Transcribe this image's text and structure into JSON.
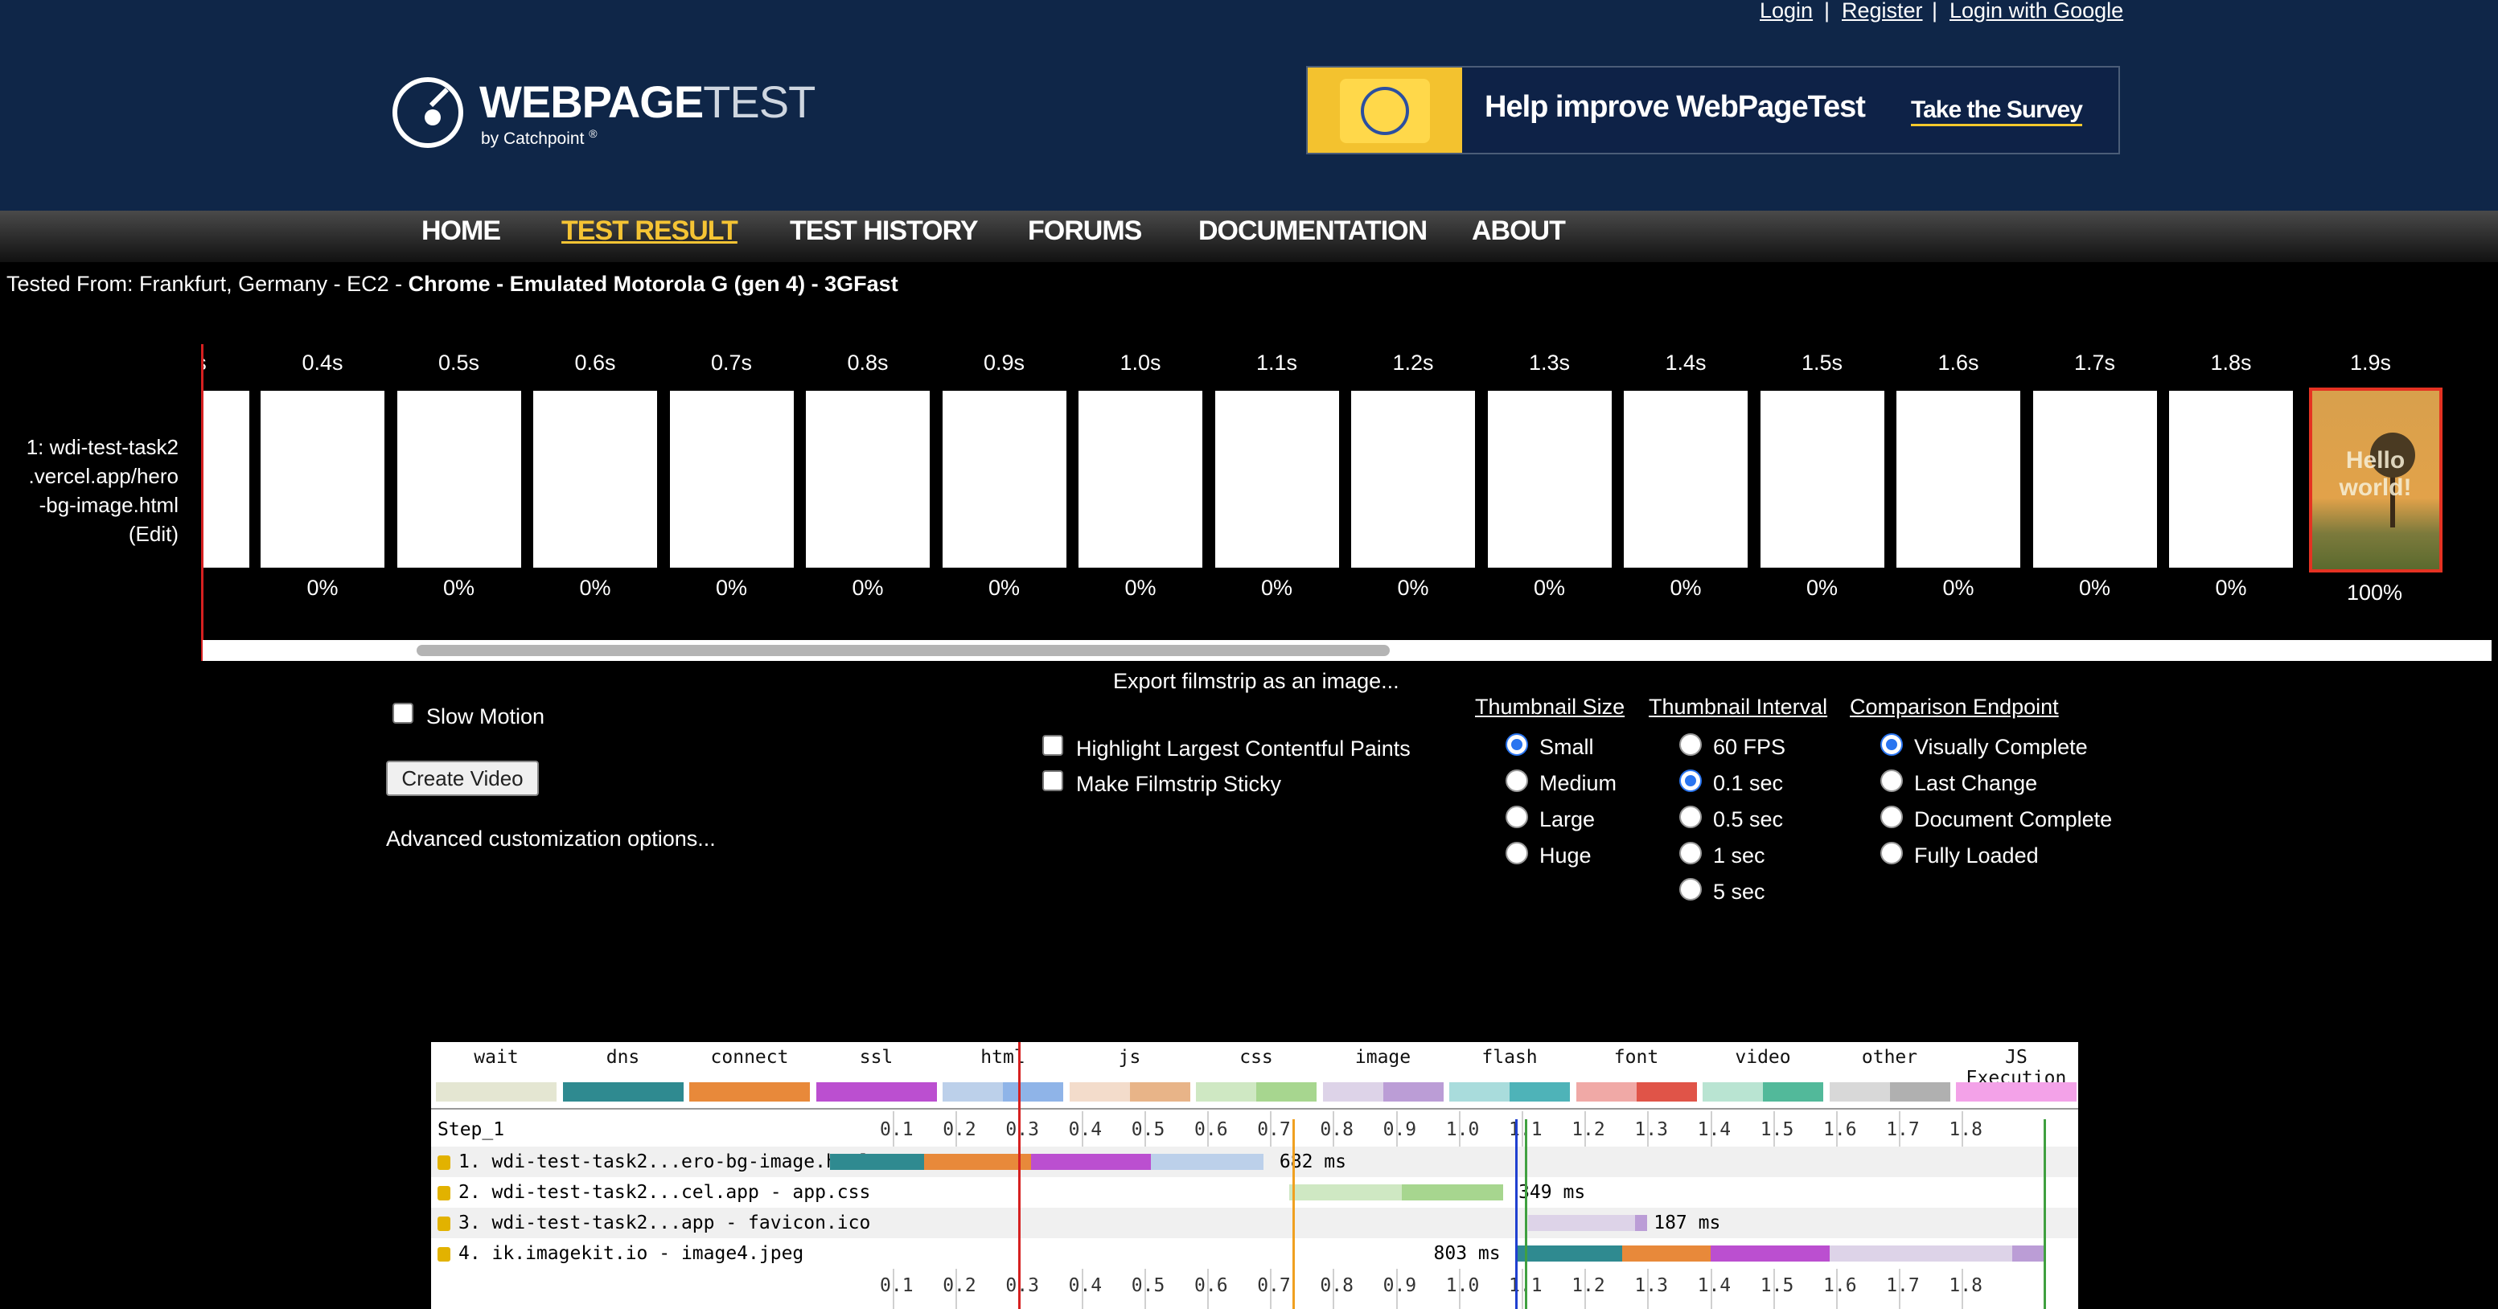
{
  "toplinks": {
    "login": "Login",
    "register": "Register",
    "google": "Login with Google",
    "sep": "|"
  },
  "logo": {
    "brand_bold": "WEBPAGE",
    "brand_thin": "TEST",
    "sub": "by Catchpoint",
    "reg": "®",
    "icon": "speedometer-icon"
  },
  "banner": {
    "text": "Help improve WebPageTest",
    "cta": "Take the Survey"
  },
  "nav": [
    "HOME",
    "TEST RESULT",
    "TEST HISTORY",
    "FORUMS",
    "DOCUMENTATION",
    "ABOUT"
  ],
  "nav_active": "TEST RESULT",
  "tested_from": {
    "prefix": "Tested From: Frankfurt, Germany - EC2 - ",
    "bold": "Chrome - Emulated Motorola G (gen 4) - 3GFast"
  },
  "filmstrip": {
    "row_label": [
      "1: wdi-test-task2",
      ".vercel.app/hero",
      "-bg-image.html",
      "(Edit)"
    ],
    "partial_label": "s",
    "frames": [
      {
        "time": "0.4s",
        "pct": "0%"
      },
      {
        "time": "0.5s",
        "pct": "0%"
      },
      {
        "time": "0.6s",
        "pct": "0%"
      },
      {
        "time": "0.7s",
        "pct": "0%"
      },
      {
        "time": "0.8s",
        "pct": "0%"
      },
      {
        "time": "0.9s",
        "pct": "0%"
      },
      {
        "time": "1.0s",
        "pct": "0%"
      },
      {
        "time": "1.1s",
        "pct": "0%"
      },
      {
        "time": "1.2s",
        "pct": "0%"
      },
      {
        "time": "1.3s",
        "pct": "0%"
      },
      {
        "time": "1.4s",
        "pct": "0%"
      },
      {
        "time": "1.5s",
        "pct": "0%"
      },
      {
        "time": "1.6s",
        "pct": "0%"
      },
      {
        "time": "1.7s",
        "pct": "0%"
      },
      {
        "time": "1.8s",
        "pct": "0%"
      }
    ],
    "last_frame": {
      "time": "1.9s",
      "pct": "100%",
      "text": [
        "Hello",
        "world!"
      ]
    }
  },
  "controls": {
    "slow_motion": "Slow Motion",
    "create_video": "Create Video",
    "advanced": "Advanced customization options...",
    "export": "Export filmstrip as an image...",
    "highlight_lcp": "Highlight Largest Contentful Paints",
    "sticky": "Make Filmstrip Sticky",
    "thumb_size": {
      "title": "Thumbnail Size",
      "options": [
        "Small",
        "Medium",
        "Large",
        "Huge"
      ],
      "selected": 0
    },
    "thumb_interval": {
      "title": "Thumbnail Interval",
      "options": [
        "60 FPS",
        "0.1 sec",
        "0.5 sec",
        "1 sec",
        "5 sec"
      ],
      "selected": 1
    },
    "endpoint": {
      "title": "Comparison Endpoint",
      "options": [
        "Visually Complete",
        "Last Change",
        "Document Complete",
        "Fully Loaded"
      ],
      "selected": 0
    }
  },
  "waterfall": {
    "legend": [
      {
        "label": "wait",
        "colors": [
          "#e4e6d2",
          "#e4e6d2"
        ]
      },
      {
        "label": "dns",
        "colors": [
          "#2f8a90",
          "#2f8a90"
        ]
      },
      {
        "label": "connect",
        "colors": [
          "#e8893a",
          "#e8893a"
        ]
      },
      {
        "label": "ssl",
        "colors": [
          "#bb4fd0",
          "#bb4fd0"
        ]
      },
      {
        "label": "html",
        "colors": [
          "#bcd0ea",
          "#8fb4e8"
        ]
      },
      {
        "label": "js",
        "colors": [
          "#f3dccb",
          "#e8b488"
        ]
      },
      {
        "label": "css",
        "colors": [
          "#cfe8c3",
          "#a7d68f"
        ]
      },
      {
        "label": "image",
        "colors": [
          "#ddd3e8",
          "#bb9dd6"
        ]
      },
      {
        "label": "flash",
        "colors": [
          "#a9dcdc",
          "#4eb3b8"
        ]
      },
      {
        "label": "font",
        "colors": [
          "#f0a9a6",
          "#e05448"
        ]
      },
      {
        "label": "video",
        "colors": [
          "#b9e4d2",
          "#52b99a"
        ]
      },
      {
        "label": "other",
        "colors": [
          "#d8d8d8",
          "#b0b0b0"
        ]
      },
      {
        "label": "JS Execution",
        "colors": [
          "#f3a2e8",
          "#f3a2e8"
        ]
      }
    ],
    "step": "Step_1",
    "ticks": [
      "0.1",
      "0.2",
      "0.3",
      "0.4",
      "0.5",
      "0.6",
      "0.7",
      "0.8",
      "0.9",
      "1.0",
      "1.1",
      "1.2",
      "1.3",
      "1.4",
      "1.5",
      "1.6",
      "1.7",
      "1.8"
    ],
    "rows": [
      {
        "label": "1. wdi-test-task2...ero-bg-image.html",
        "duration": "682 ms"
      },
      {
        "label": "2. wdi-test-task2...cel.app - app.css",
        "duration": "349 ms"
      },
      {
        "label": "3. wdi-test-task2...app - favicon.ico",
        "duration": "187 ms"
      },
      {
        "label": "4. ik.imagekit.io - image4.jpeg",
        "duration": "803 ms"
      }
    ]
  }
}
